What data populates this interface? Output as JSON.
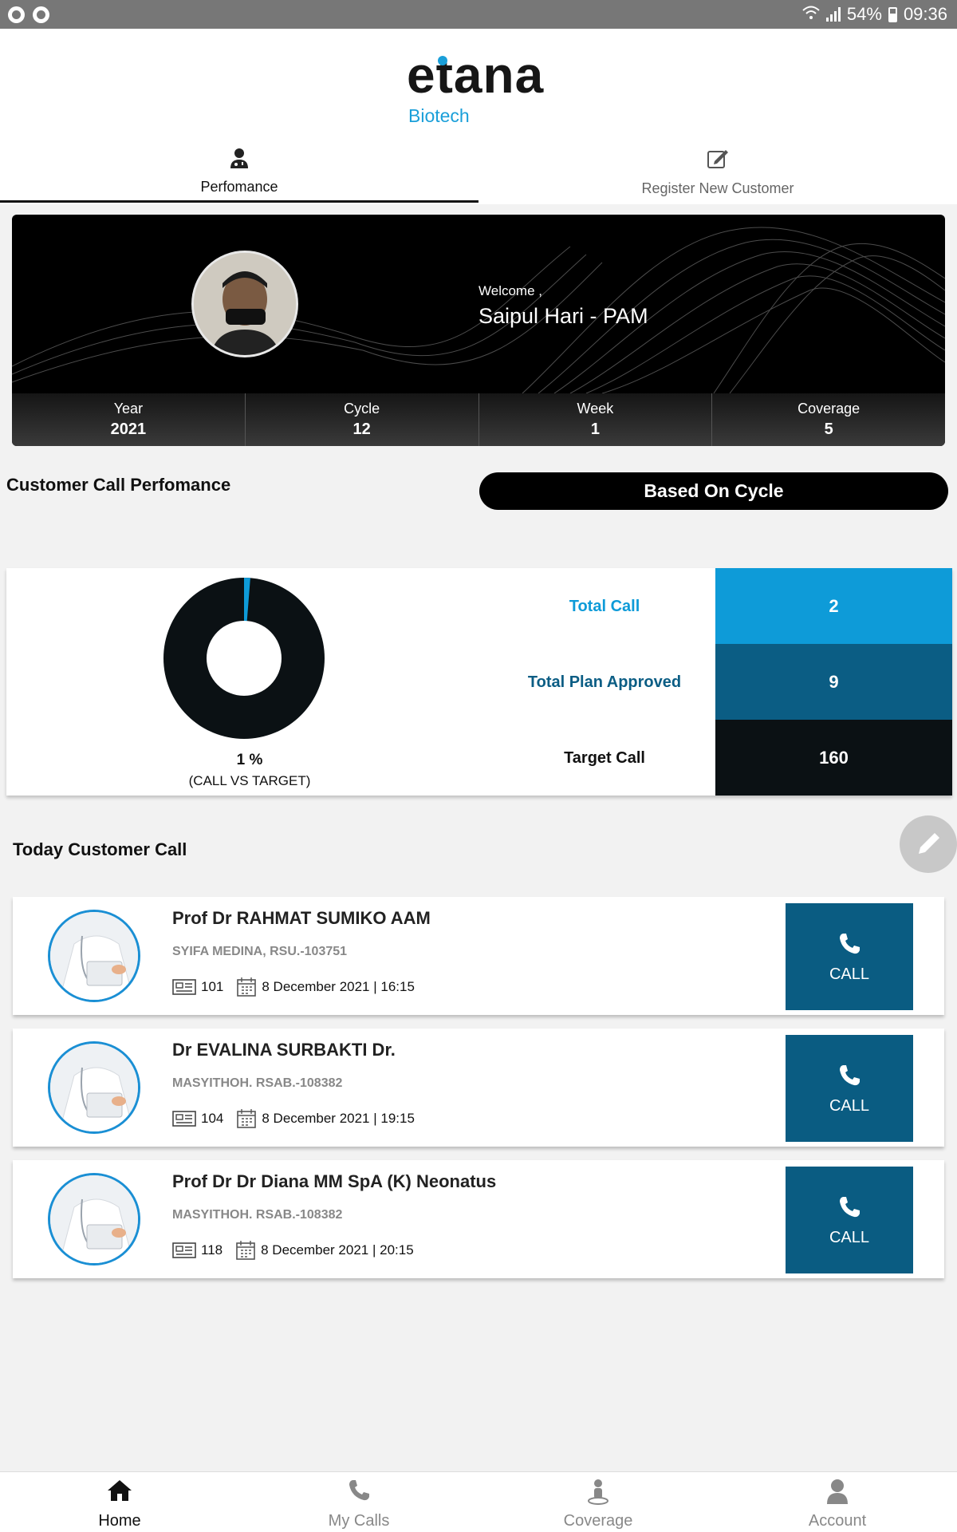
{
  "status_bar": {
    "battery": "54%",
    "time": "09:36"
  },
  "brand": {
    "name": "etana",
    "sub": "Biotech"
  },
  "tabs": [
    {
      "label": "Perfomance",
      "icon": "doctor-icon"
    },
    {
      "label": "Register New Customer",
      "icon": "edit-icon"
    }
  ],
  "profile": {
    "welcome": "Welcome  ,",
    "name": "Saipul Hari - PAM"
  },
  "stats": [
    {
      "label": "Year",
      "value": "2021"
    },
    {
      "label": "Cycle",
      "value": "12"
    },
    {
      "label": "Week",
      "value": "1"
    },
    {
      "label": "Coverage",
      "value": "5"
    }
  ],
  "performance": {
    "title": "Customer Call Perfomance",
    "filter_label": "Based On Cycle",
    "percent_text": "1 %",
    "percent_caption": "(CALL VS TARGET)",
    "ratio": 0.0125,
    "metrics": [
      {
        "label": "Total Call",
        "value": "2",
        "label_color": "#0e9bd8",
        "box_color": "#0e9bd8"
      },
      {
        "label": "Total Plan Approved",
        "value": "9",
        "label_color": "#0b5d84",
        "box_color": "#0b5d84"
      },
      {
        "label": "Target Call",
        "value": "160",
        "label_color": "#111111",
        "box_color": "#0b1114"
      }
    ]
  },
  "today": {
    "title": "Today Customer Call",
    "call_label": "CALL",
    "items": [
      {
        "name": "Prof Dr RAHMAT  SUMIKO AAM",
        "org": "SYIFA MEDINA, RSU.-103751",
        "id": "101",
        "date": "8 December 2021 | 16:15"
      },
      {
        "name": "Dr EVALINA  SURBAKTI Dr.",
        "org": "MASYITHOH. RSAB.-108382",
        "id": "104",
        "date": "8 December 2021 | 19:15"
      },
      {
        "name": "Prof Dr Dr  Diana MM SpA (K) Neonatus",
        "org": "MASYITHOH. RSAB.-108382",
        "id": "118",
        "date": "8 December 2021 | 20:15"
      }
    ]
  },
  "bottom_nav": [
    {
      "label": "Home",
      "icon": "home-icon"
    },
    {
      "label": "My Calls",
      "icon": "phone-icon"
    },
    {
      "label": "Coverage",
      "icon": "coverage-icon"
    },
    {
      "label": "Account",
      "icon": "account-icon"
    }
  ]
}
